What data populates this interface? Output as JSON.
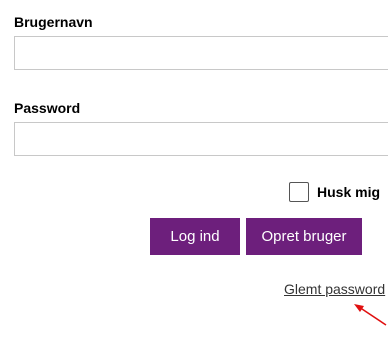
{
  "form": {
    "username_label": "Brugernavn",
    "username_value": "",
    "password_label": "Password",
    "password_value": "",
    "remember_label": "Husk mig",
    "login_button": "Log ind",
    "create_button": "Opret bruger",
    "forgot_link": "Glemt password"
  },
  "colors": {
    "button_bg": "#6d1f7c",
    "arrow": "#e01010"
  }
}
